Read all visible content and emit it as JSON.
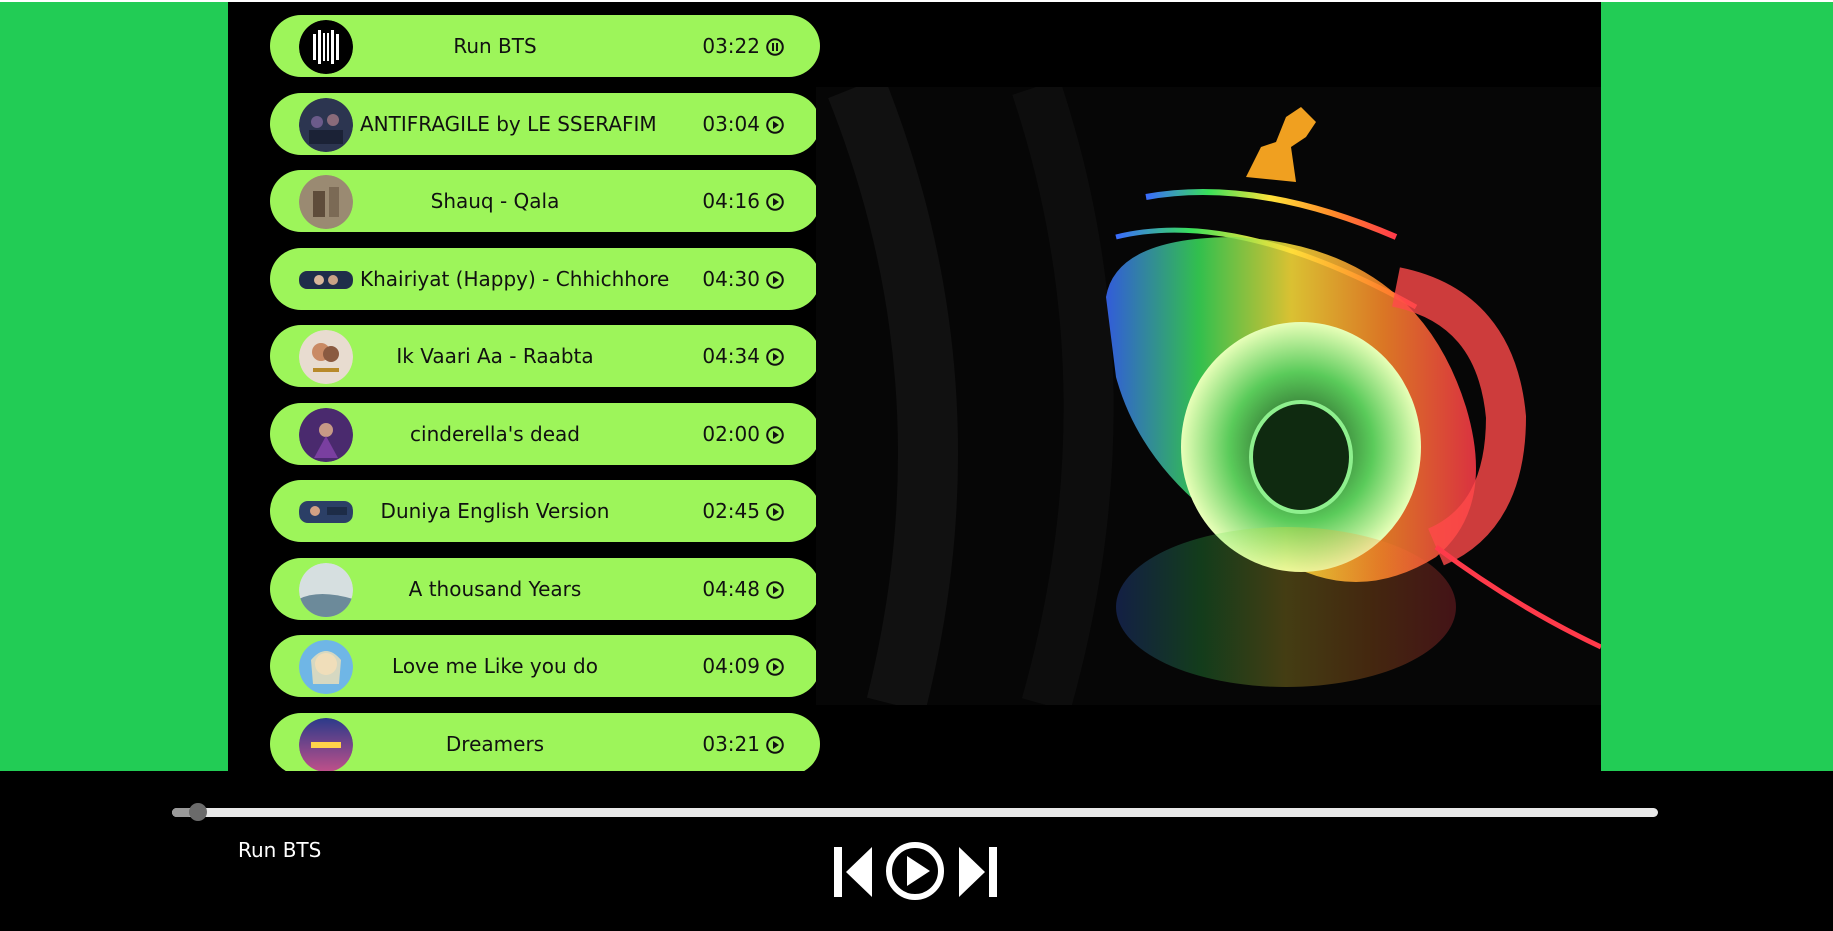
{
  "songs": [
    {
      "title": "Run BTS",
      "duration": "03:22",
      "state": "pause"
    },
    {
      "title": "ANTIFRAGILE by LE SSERAFIM",
      "duration": "03:04",
      "state": "play"
    },
    {
      "title": "Shauq - Qala",
      "duration": "04:16",
      "state": "play"
    },
    {
      "title": "Khairiyat (Happy) - Chhichhore",
      "duration": "04:30",
      "state": "play"
    },
    {
      "title": "Ik Vaari Aa - Raabta",
      "duration": "04:34",
      "state": "play"
    },
    {
      "title": "cinderella's dead",
      "duration": "02:00",
      "state": "play"
    },
    {
      "title": "Duniya English Version",
      "duration": "02:45",
      "state": "play"
    },
    {
      "title": "A thousand Years",
      "duration": "04:48",
      "state": "play"
    },
    {
      "title": "Love me Like you do",
      "duration": "04:09",
      "state": "play"
    },
    {
      "title": "Dreamers",
      "duration": "03:21",
      "state": "play"
    }
  ],
  "player": {
    "now_playing": "Run BTS",
    "progress": 0.014
  },
  "colors": {
    "page_background": "#22cc55",
    "song_pill": "#9df55a",
    "panel": "#000000"
  }
}
